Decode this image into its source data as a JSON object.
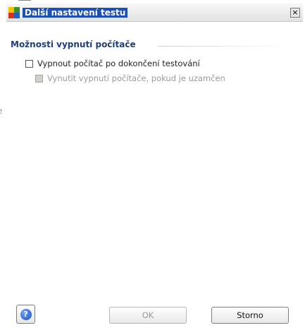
{
  "window": {
    "title": "Další nastavení testu",
    "close_label": "×"
  },
  "section": {
    "title": "Možnosti vypnutí počítače"
  },
  "options": [
    {
      "label": "Vypnout počítač po dokončení testování",
      "checked": false,
      "enabled": true
    },
    {
      "label": "Vynutit vypnutí počítače, pokud je uzamčen",
      "checked": false,
      "enabled": false
    }
  ],
  "footer": {
    "help_glyph": "?",
    "ok_label": "OK",
    "ok_enabled": false,
    "cancel_label": "Storno"
  },
  "colors": {
    "title_highlight": "#1e4fb5",
    "section_title": "#1f3e7a",
    "disabled_text": "#9a9a9a"
  },
  "icons": [
    "app-icon",
    "close-icon",
    "help-icon"
  ]
}
